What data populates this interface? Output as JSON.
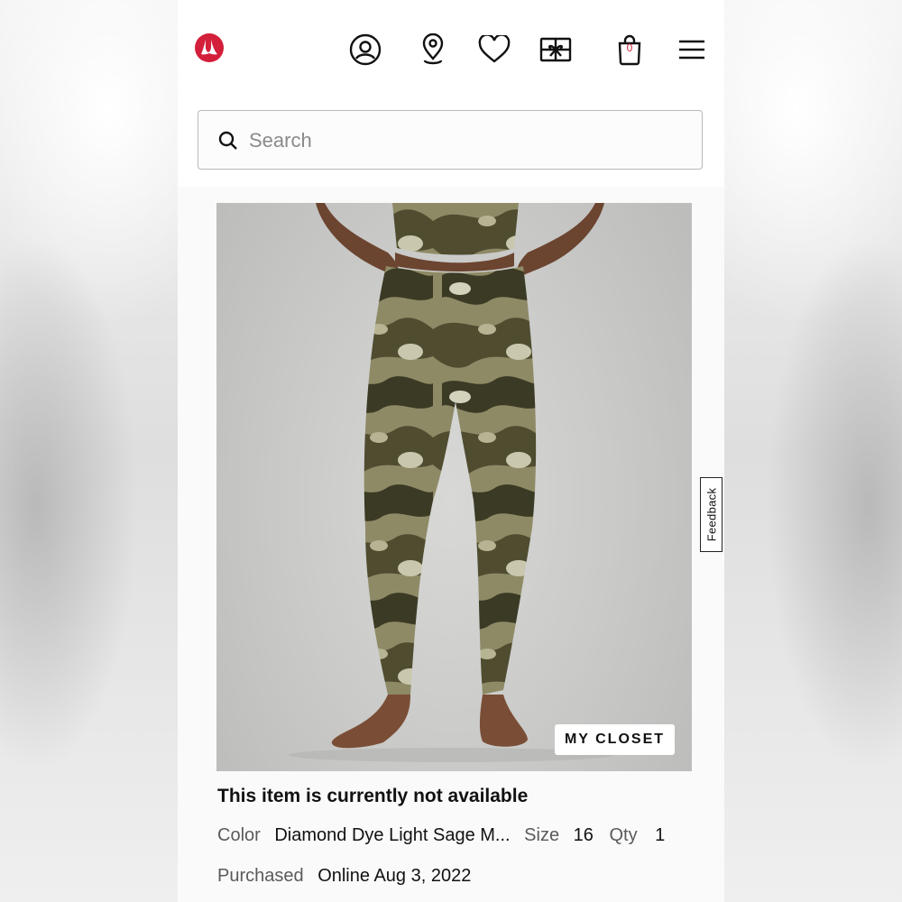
{
  "header": {
    "logo": "lululemon-logo",
    "icons": [
      "account-icon",
      "store-locator-icon",
      "wishlist-heart-icon",
      "gift-card-icon",
      "shopping-bag-icon",
      "menu-hamburger-icon"
    ],
    "bag_count": "0",
    "brand_color": "#d31f3a"
  },
  "search": {
    "placeholder": "Search"
  },
  "product": {
    "badge": "MY CLOSET",
    "availability": "This item is currently not available",
    "color_label": "Color",
    "color_value": "Diamond Dye Light Sage M...",
    "size_label": "Size",
    "size_value": "16",
    "qty_label": "Qty",
    "qty_value": "1",
    "purchased_label": "Purchased",
    "purchased_value": "Online Aug 3, 2022"
  },
  "feedback": {
    "label": "Feedback"
  }
}
